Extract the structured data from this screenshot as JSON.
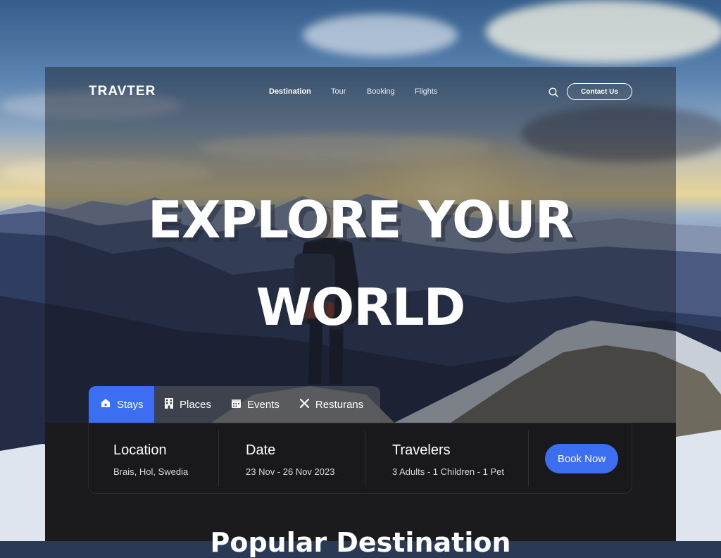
{
  "brand": {
    "logo": "TRAVTER"
  },
  "nav": {
    "items": [
      {
        "label": "Destination",
        "active": true
      },
      {
        "label": "Tour",
        "active": false
      },
      {
        "label": "Booking",
        "active": false
      },
      {
        "label": "Flights",
        "active": false
      }
    ],
    "search_icon": "search-icon",
    "contact_label": "Contact Us"
  },
  "hero": {
    "line1": "EXPLORE YOUR",
    "line2": "WORLD"
  },
  "tabs": [
    {
      "label": "Stays",
      "icon": "house-icon",
      "active": true
    },
    {
      "label": "Places",
      "icon": "building-icon",
      "active": false
    },
    {
      "label": "Events",
      "icon": "calendar-icon",
      "active": false
    },
    {
      "label": "Resturans",
      "icon": "utensils-icon",
      "active": false
    }
  ],
  "booking": {
    "location": {
      "title": "Location",
      "value": "Brais, Hol, Swedia"
    },
    "date": {
      "title": "Date",
      "value": "23 Nov - 26 Nov 2023"
    },
    "travelers": {
      "title": "Travelers",
      "value": "3 Adults - 1 Children - 1 Pet"
    },
    "book_label": "Book Now"
  },
  "section": {
    "title": "Popular Destination"
  },
  "colors": {
    "accent": "#3b6ef0",
    "dark": "#19191b"
  }
}
